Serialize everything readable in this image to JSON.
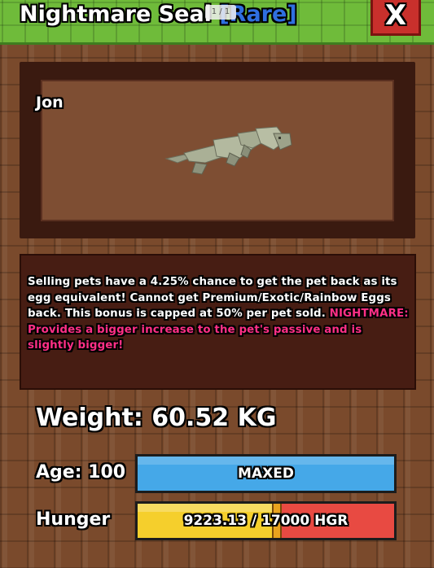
{
  "header": {
    "title": "Nightmare Seal",
    "rarity": "[Rare]",
    "page_indicator": "1 / 1",
    "close_label": "X"
  },
  "pet": {
    "name": "Jon",
    "model_icon": "seal-model"
  },
  "description": {
    "main": "Selling pets have a 4.25% chance to get the pet back as its egg equivalent! Cannot get Premium/Exotic/Rainbow Eggs back. This bonus is capped at 50% per pet sold.",
    "nightmare": "NIGHTMARE: Provides a bigger increase to the pet's passive and is slightly bigger!"
  },
  "stats": {
    "weight": "Weight: 60.52 KG",
    "age_label": "Age: 100",
    "age_bar_text": "MAXED",
    "age_fill_fraction": 1.0,
    "hunger_label": "Hunger",
    "hunger_text": "9223.13 / 17000 HGR",
    "hunger_fill_fraction": 0.5425
  },
  "colors": {
    "header_green": "#6fbb3a",
    "rarity_blue": "#2f6fe0",
    "nightmare_pink": "#ff2f86",
    "age_bar_blue": "#45a8e8",
    "hunger_yellow": "#f5cf2c",
    "hunger_red": "#e84a42",
    "close_red": "#c9302c"
  }
}
